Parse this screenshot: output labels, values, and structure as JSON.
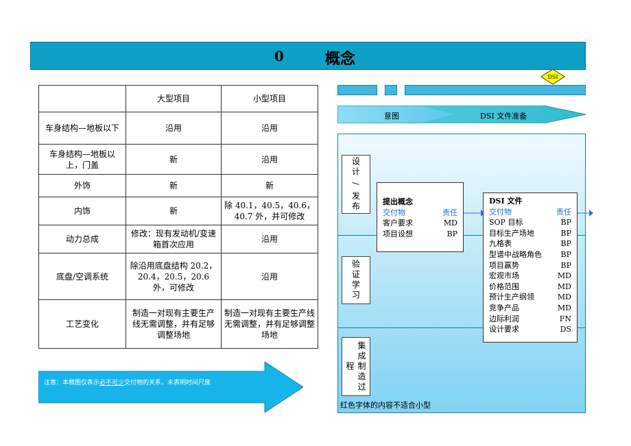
{
  "title": {
    "number": "0",
    "text": "概念"
  },
  "table": {
    "headers": [
      "",
      "大型项目",
      "小型项目"
    ],
    "rows": [
      [
        "车身结构—地板以下",
        "沿用",
        "沿用"
      ],
      [
        "车身结构—地板以上，门盖",
        "新",
        "沿用"
      ],
      [
        "外饰",
        "新",
        "新"
      ],
      [
        "内饰",
        "新",
        "除 40.1，40.5，40.6，40.7 外，并可修改"
      ],
      [
        "动力总成",
        "修改：现有发动机/变速箱首次应用",
        "沿用"
      ],
      [
        "底盘/空调系统",
        "除沿用底盘结构 20.2，20.4，20.5，20.6 外，可修改",
        "沿用"
      ],
      [
        "工艺变化",
        "制造一对现有主要生产线无需调整，并有足够调整场地",
        "制造一对现有主要生产线无需调整，并有足够调整场地"
      ]
    ]
  },
  "note": {
    "prefix": "注意：本框图仅表示",
    "underlined": "必不可少",
    "suffix": "交付物的关系，未表明时间尺度"
  },
  "milestone": "DSI",
  "phases": [
    "意图",
    "DSI 文件准备"
  ],
  "side_labels": [
    "设计 / 发布",
    "验证学习",
    "集成制造过程"
  ],
  "concept_box": {
    "title": "提出概念",
    "header": [
      "交付物",
      "责任"
    ],
    "items": [
      [
        "客户要求",
        "MD"
      ],
      [
        "项目设想",
        "BP"
      ]
    ]
  },
  "dsi_box": {
    "title": "DSI 文件",
    "header": [
      "交付物",
      "责任"
    ],
    "items": [
      [
        "SOP 目标",
        "BP"
      ],
      [
        "目标生产场地",
        "BP"
      ],
      [
        "九格表",
        "BP"
      ],
      [
        "型谱中战略角色",
        "BP"
      ],
      [
        "项目赢势",
        "BP"
      ],
      [
        "宏观市场",
        "MD"
      ],
      [
        "价格范围",
        "MD"
      ],
      [
        "预计生产纲领",
        "MD"
      ],
      [
        "竞争产品",
        "MD"
      ],
      [
        "边际利润",
        "FN"
      ],
      [
        "设计要求",
        "DS"
      ]
    ]
  },
  "panel_footer": "红色字体的内容不适合小型",
  "colors": {
    "title_bar": "#0fa0c8",
    "bar": "#41b8e2",
    "milestone": "#ffff00",
    "accent_text": "#1a6fe0"
  }
}
